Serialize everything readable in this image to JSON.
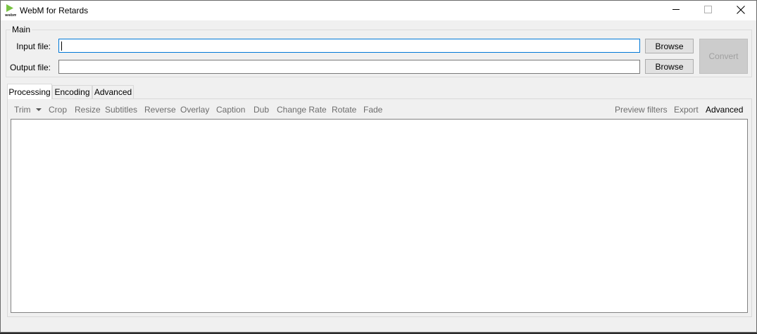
{
  "window": {
    "title": "WebM for Retards",
    "icon": "webm-play-icon",
    "icon_caption": "webm"
  },
  "main_group": {
    "label": "Main",
    "input_label": "Input file:",
    "input_value": "",
    "output_label": "Output file:",
    "output_value": "",
    "browse_label": "Browse",
    "convert_label": "Convert"
  },
  "tabs": [
    {
      "label": "Processing",
      "active": true
    },
    {
      "label": "Encoding",
      "active": false
    },
    {
      "label": "Advanced",
      "active": false
    }
  ],
  "toolbar": {
    "left": [
      "Trim",
      "Crop",
      "Resize",
      "Subtitles",
      "Reverse",
      "Overlay",
      "Caption",
      "Dub",
      "Change Rate",
      "Rotate",
      "Fade"
    ],
    "right": [
      "Preview filters",
      "Export",
      "Advanced"
    ]
  },
  "colors": {
    "accent": "#0078d7",
    "logo_green": "#78c342"
  }
}
